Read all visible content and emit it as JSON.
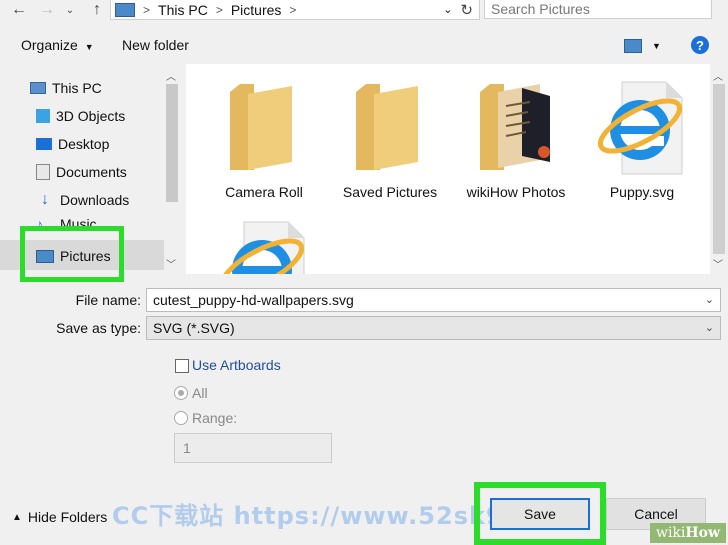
{
  "address": {
    "crumbs": [
      "This PC",
      "Pictures"
    ],
    "search_placeholder": "Search Pictures"
  },
  "toolbar": {
    "organize_label": "Organize",
    "new_folder_label": "New folder",
    "help_label": "?"
  },
  "nav": {
    "items": [
      {
        "label": "This PC",
        "icon": "pc-icon"
      },
      {
        "label": "3D Objects",
        "icon": "cube-icon"
      },
      {
        "label": "Desktop",
        "icon": "desktop-icon"
      },
      {
        "label": "Documents",
        "icon": "documents-icon"
      },
      {
        "label": "Downloads",
        "icon": "download-arrow-icon"
      },
      {
        "label": "Music",
        "icon": "music-icon"
      },
      {
        "label": "Pictures",
        "icon": "pictures-icon"
      }
    ],
    "selected": "Pictures"
  },
  "files": [
    {
      "label": "Camera Roll",
      "type": "folder"
    },
    {
      "label": "Saved Pictures",
      "type": "folder"
    },
    {
      "label": "wikiHow Photos",
      "type": "folder-with-content"
    },
    {
      "label": "Puppy.svg",
      "type": "ie-file"
    },
    {
      "label": "",
      "type": "ie-file"
    }
  ],
  "form": {
    "filename_label": "File name:",
    "filename_value": "cutest_puppy-hd-wallpapers.svg",
    "savetype_label": "Save as type:",
    "savetype_value": "SVG (*.SVG)"
  },
  "options": {
    "use_artboards": "Use Artboards",
    "all": "All",
    "range": "Range:",
    "range_value": "1"
  },
  "bottom": {
    "hide_folders": "Hide Folders",
    "save": "Save",
    "cancel": "Cancel"
  },
  "overlay": {
    "watermark": "CC下载站 https://www.52sk9.net",
    "brand_wiki": "wiki",
    "brand_how": "How"
  },
  "colors": {
    "highlight": "#2bdc2b",
    "accent": "#1a6fd8",
    "folder": "#f0cd7a"
  }
}
